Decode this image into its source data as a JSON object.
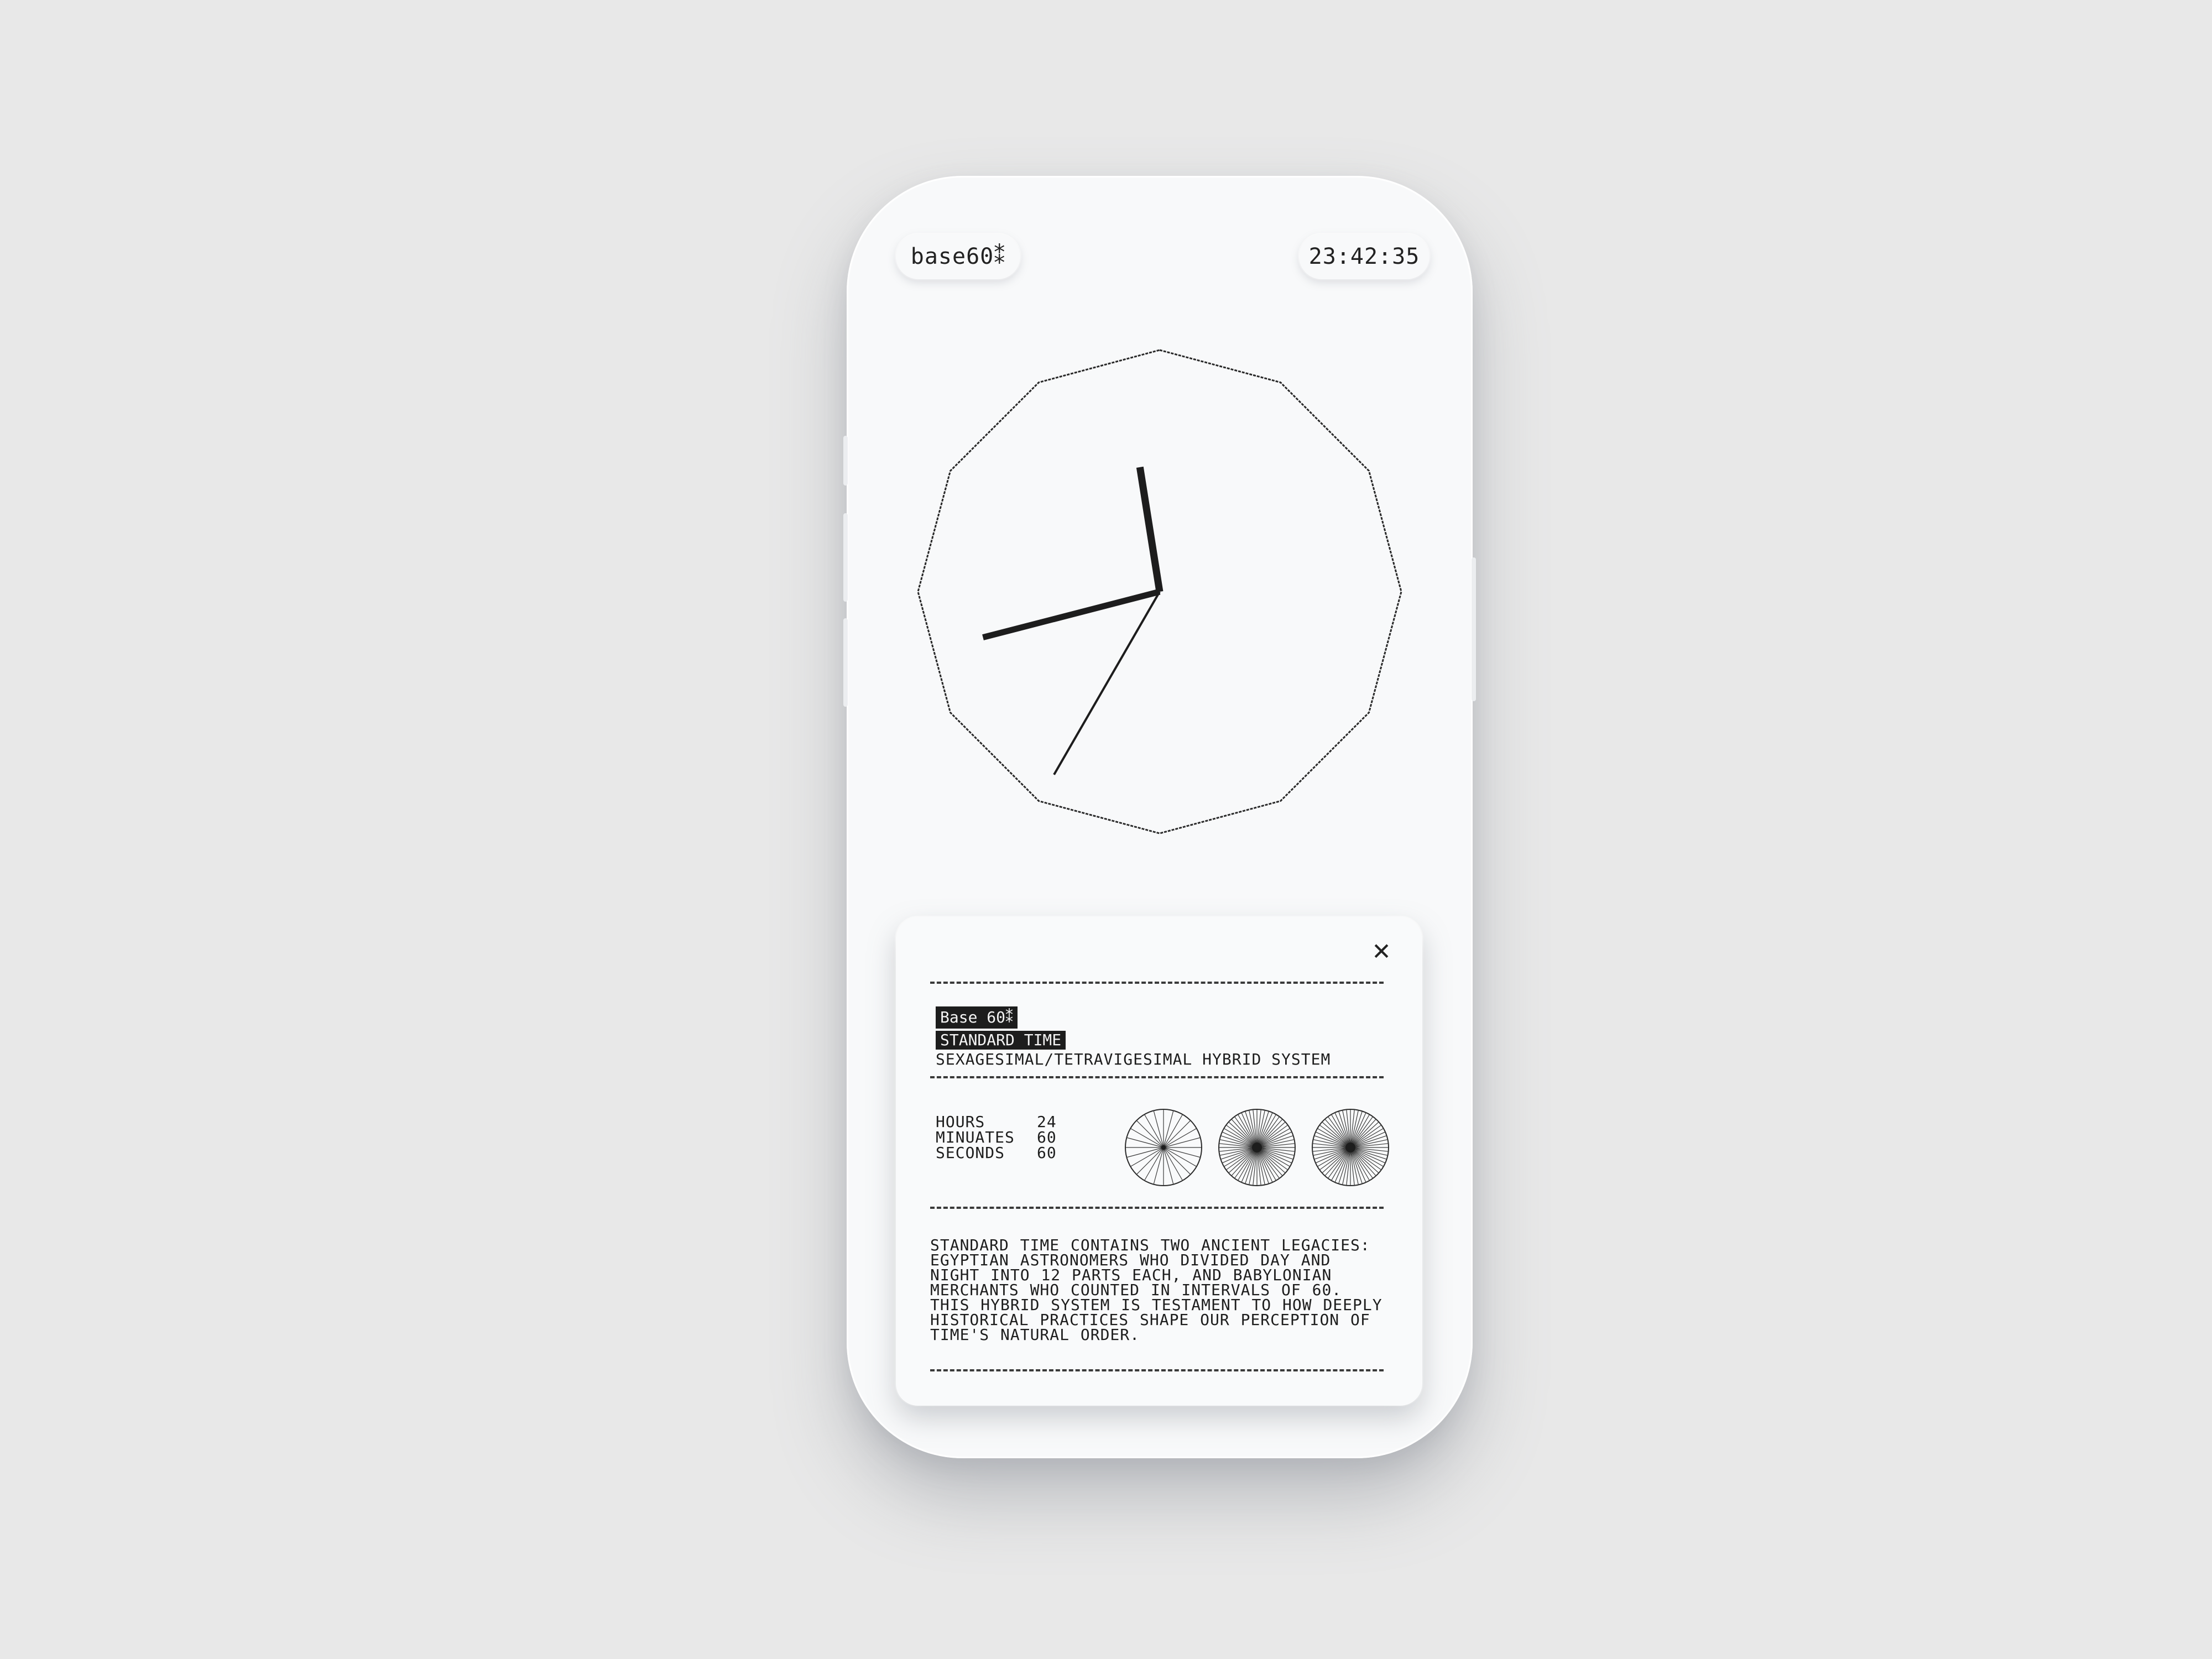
{
  "header": {
    "brand": "base60⁑",
    "time": "23:42:35"
  },
  "clock": {
    "hours": 23,
    "minutes": 42,
    "seconds": 35
  },
  "info_card": {
    "close_icon": "close-icon",
    "close_glyph": "✕",
    "tag": "Base 60⁑",
    "heading": "STANDARD TIME",
    "subtitle": "SEXAGESIMAL/TETRAVIGESIMAL HYBRID SYSTEM",
    "stats": [
      {
        "label": "HOURS",
        "value": "24"
      },
      {
        "label": "MINUATES",
        "value": "60"
      },
      {
        "label": "SECONDS",
        "value": "60"
      }
    ],
    "dials": [
      {
        "name": "hours-dial",
        "spokes": 24
      },
      {
        "name": "minutes-dial",
        "spokes": 60
      },
      {
        "name": "seconds-dial",
        "spokes": 60
      }
    ],
    "description": "STANDARD TIME CONTAINS TWO ANCIENT LEGACIES: EGYPTIAN ASTRONOMERS WHO DIVIDED DAY AND NIGHT INTO 12 PARTS EACH, AND BABYLONIAN MERCHANTS WHO COUNTED IN INTERVALS OF 60. THIS HYBRID SYSTEM IS TESTAMENT TO HOW DEEPLY HISTORICAL PRACTICES SHAPE OUR PERCEPTION OF TIME'S NATURAL ORDER."
  },
  "colors": {
    "background": "#e8e8e8",
    "device": "#f8f9fa",
    "ink": "#1d1d1d"
  }
}
